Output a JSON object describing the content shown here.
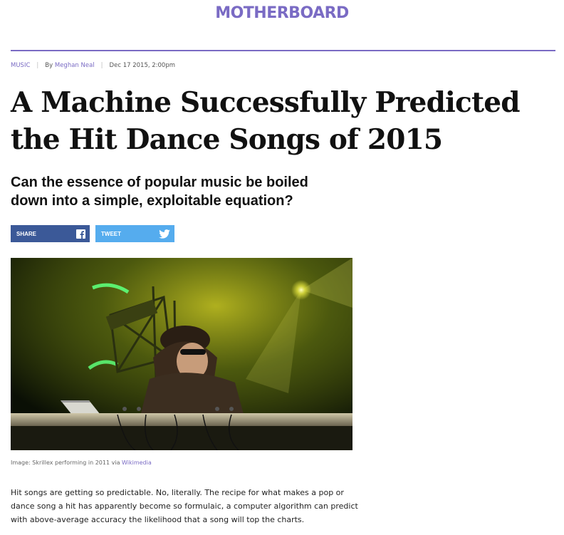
{
  "site": {
    "logo": "MOTHERBOARD"
  },
  "meta": {
    "category": "MUSIC",
    "by_prefix": "By",
    "author": "Meghan Neal",
    "date": "Dec 17 2015, 2:00pm"
  },
  "article": {
    "headline_line1": "A Machine Successfully Predicted",
    "headline_line2": "the Hit Dance Songs of 2015",
    "dek_line1": "Can the essence of popular music be boiled",
    "dek_line2": "down into a simple, exploitable equation?",
    "body_line1": "Hit songs are getting so predictable. No, literally. The recipe for what makes a pop or",
    "body_line2": "dance song a hit has apparently become so formulaic, a computer algorithm can predict",
    "body_line3": "with above-average accuracy the likelihood that a song will top the charts."
  },
  "share": {
    "facebook_label": "SHARE",
    "twitter_label": "TWEET",
    "facebook_icon": "facebook-icon",
    "twitter_icon": "twitter-icon"
  },
  "image": {
    "caption_prefix": "Image: Skrillex performing in 2011 via",
    "caption_link": "Wikimedia"
  },
  "colors": {
    "brand": "#7a6bc4",
    "facebook": "#3b5998",
    "twitter": "#55acee"
  }
}
